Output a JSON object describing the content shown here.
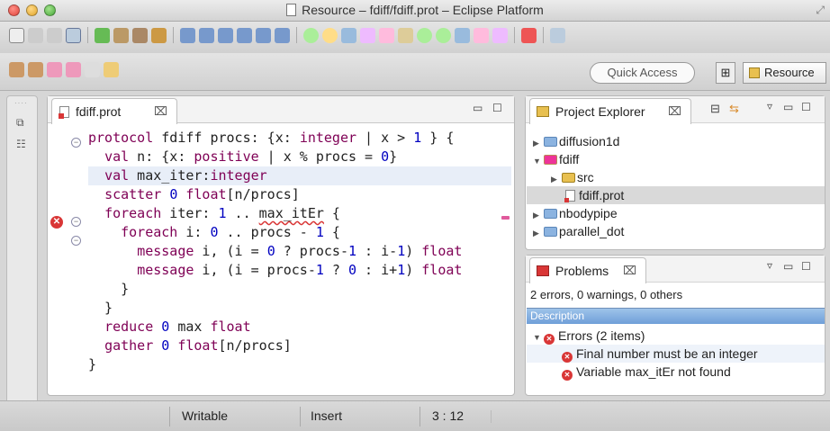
{
  "window": {
    "title": "Resource – fdiff/fdiff.prot – Eclipse Platform"
  },
  "toolbar": {
    "quick_access": "Quick Access",
    "perspective": "Resource"
  },
  "editor": {
    "tab_label": "fdiff.prot",
    "code_lines": [
      {
        "text": "protocol fdiff procs: {x: integer | x > 1 } {",
        "indent": 0
      },
      {
        "text": "val n: {x: positive | x % procs = 0}",
        "indent": 1
      },
      {
        "text": "val max_iter:integer",
        "indent": 1,
        "highlighted": true
      },
      {
        "text": "scatter 0 float[n/procs]",
        "indent": 1
      },
      {
        "text": "foreach iter: 1 .. max_itEr {",
        "indent": 1,
        "error_token": "max_itEr"
      },
      {
        "text": "foreach i: 0 .. procs - 1 {",
        "indent": 2
      },
      {
        "text": "message i, (i = 0 ? procs-1 : i-1) float",
        "indent": 3
      },
      {
        "text": "message i, (i = procs-1 ? 0 : i+1) float",
        "indent": 3
      },
      {
        "text": "}",
        "indent": 2
      },
      {
        "text": "}",
        "indent": 1
      },
      {
        "text": "reduce 0 max float",
        "indent": 1
      },
      {
        "text": "gather 0 float[n/procs]",
        "indent": 1
      },
      {
        "text": "}",
        "indent": 0
      }
    ]
  },
  "project_explorer": {
    "tab_label": "Project Explorer",
    "items": [
      {
        "label": "diffusion1d",
        "kind": "project",
        "expanded": false
      },
      {
        "label": "fdiff",
        "kind": "project",
        "expanded": true
      },
      {
        "label": "src",
        "kind": "folder",
        "expanded": false
      },
      {
        "label": "fdiff.prot",
        "kind": "file",
        "selected": true
      },
      {
        "label": "nbodypipe",
        "kind": "project",
        "expanded": false
      },
      {
        "label": "parallel_dot",
        "kind": "project",
        "expanded": false
      }
    ]
  },
  "problems": {
    "tab_label": "Problems",
    "summary": "2 errors, 0 warnings, 0 others",
    "column_header": "Description",
    "group_label": "Errors (2 items)",
    "errors": [
      "Final number must be an integer",
      "Variable max_itEr not found"
    ]
  },
  "statusbar": {
    "writable": "Writable",
    "insert_mode": "Insert",
    "position": "3 : 12"
  },
  "colors": {
    "keyword": "#7f0055",
    "number": "#0000c0",
    "error": "#d93636",
    "selection": "#e8eef8"
  }
}
